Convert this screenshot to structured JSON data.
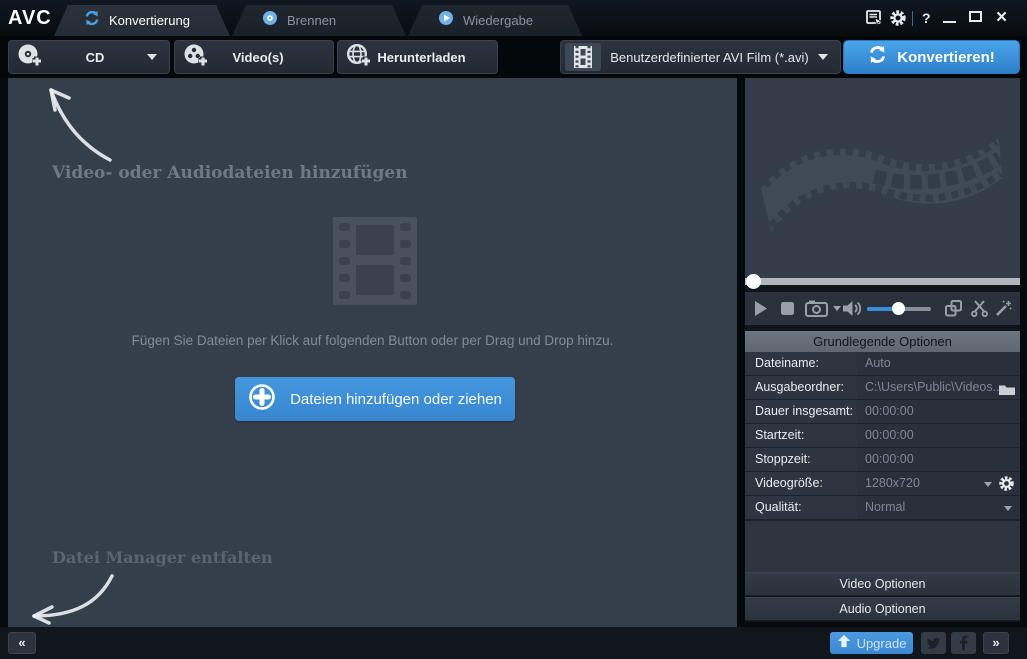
{
  "window": {
    "logo": "AVC"
  },
  "titlebar": {
    "tabs": [
      {
        "label": "Konvertierung",
        "active": true
      },
      {
        "label": "Brennen",
        "active": false
      },
      {
        "label": "Wiedergabe",
        "active": false
      }
    ],
    "help_label": "?",
    "close_glyph": "×"
  },
  "toolbar": {
    "cd_label": "CD",
    "videos_label": "Video(s)",
    "download_label": "Herunterladen",
    "format_value": "Benutzerdefinierter AVI Film (*.avi)",
    "convert_label": "Konvertieren!"
  },
  "main": {
    "add_hint": "Video- oder Audiodateien hinzufügen",
    "drop_hint": "Fügen Sie Dateien per Klick auf folgenden Button oder per Drag und Drop hinzu.",
    "add_button_label": "Dateien hinzufügen oder ziehen",
    "manager_hint": "Datei Manager entfalten"
  },
  "options": {
    "header": "Grundlegende Optionen",
    "rows": [
      {
        "label": "Dateiname:",
        "value": "Auto"
      },
      {
        "label": "Ausgabeordner:",
        "value": "C:\\Users\\Public\\Videos..."
      },
      {
        "label": "Dauer insgesamt:",
        "value": "00:00:00"
      },
      {
        "label": "Startzeit:",
        "value": "00:00:00"
      },
      {
        "label": "Stoppzeit:",
        "value": "00:00:00"
      },
      {
        "label": "Videogröße:",
        "value": "1280x720"
      },
      {
        "label": "Qualität:",
        "value": "Normal"
      }
    ],
    "video_section": "Video Optionen",
    "audio_section": "Audio Optionen"
  },
  "statusbar": {
    "collapse_label": "«",
    "expand_label": "»",
    "upgrade_label": "Upgrade"
  },
  "colors": {
    "accent_blue": "#3a8ed8",
    "titlebar_bg": "#0b0f15",
    "main_bg": "#353f4b",
    "panel_bg": "#2d343e",
    "options_header_bg": "#666e78"
  }
}
